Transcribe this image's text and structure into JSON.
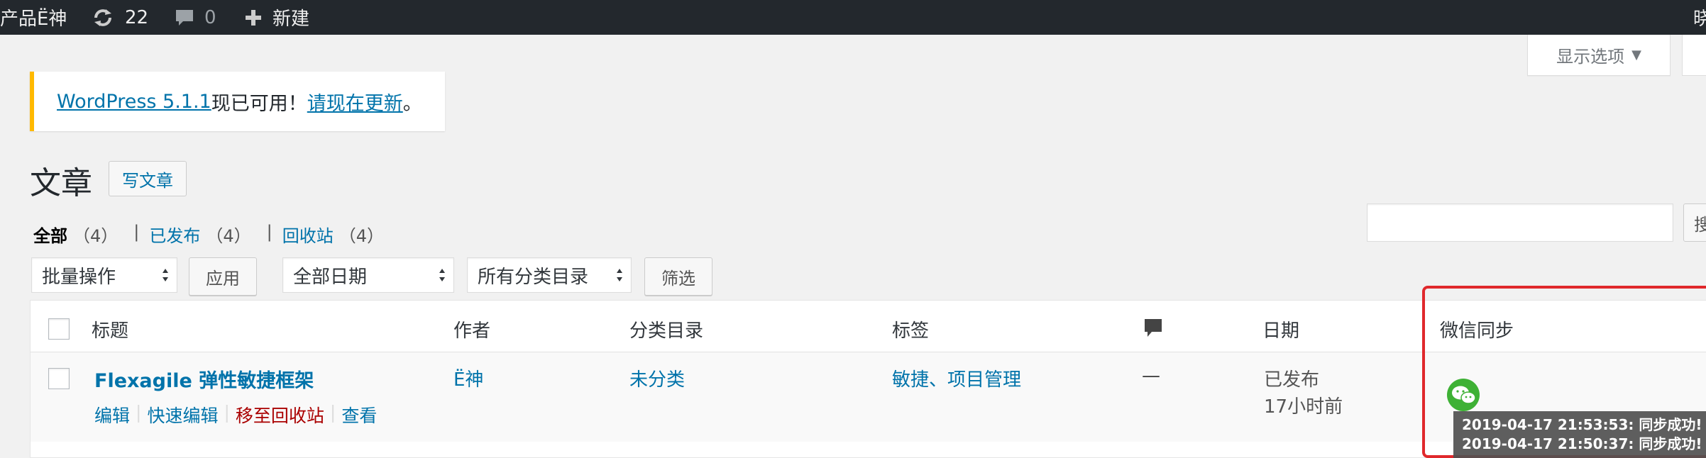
{
  "adminbar": {
    "site_name": "产品Ë神",
    "updates_count": "22",
    "comments_count": "0",
    "new_label": "新建",
    "right_fragment": "晓"
  },
  "screen_options": {
    "label": "显示选项"
  },
  "notice": {
    "version_link": "WordPress 5.1.1",
    "available_text": "现已可用！",
    "update_link": "请现在更新",
    "end": "。"
  },
  "page": {
    "title": "文章",
    "add_new": "写文章"
  },
  "views": [
    {
      "label": "全部",
      "count": "（4）"
    },
    {
      "label": "已发布",
      "count": "（4）"
    },
    {
      "label": "回收站",
      "count": "（4）"
    }
  ],
  "search": {
    "button_fragment": "搜"
  },
  "filters": {
    "bulk_action": "批量操作",
    "apply": "应用",
    "date": "全部日期",
    "category": "所有分类目录",
    "filter": "筛选"
  },
  "table": {
    "headers": {
      "title": "标题",
      "author": "作者",
      "categories": "分类目录",
      "tags": "标签",
      "date": "日期",
      "wechat_sync": "微信同步"
    },
    "rows": [
      {
        "title": "Flexagile 弹性敏捷框架",
        "actions": {
          "edit": "编辑",
          "quick_edit": "快速编辑",
          "trash": "移至回收站",
          "view": "查看"
        },
        "author": "Ë神",
        "category": "未分类",
        "tags": "敏捷、项目管理",
        "comments": "—",
        "date_status": "已发布",
        "date_ago": "17小时前"
      }
    ]
  },
  "sync_log": [
    "2019-04-17 21:53:53: 同步成功!",
    "2019-04-17 21:50:37: 同步成功!"
  ],
  "colors": {
    "admin_bar": "#23282d",
    "link": "#0073aa",
    "notice_border": "#ffb900",
    "highlight": "#e0282c",
    "wechat_green": "#3eb135"
  }
}
